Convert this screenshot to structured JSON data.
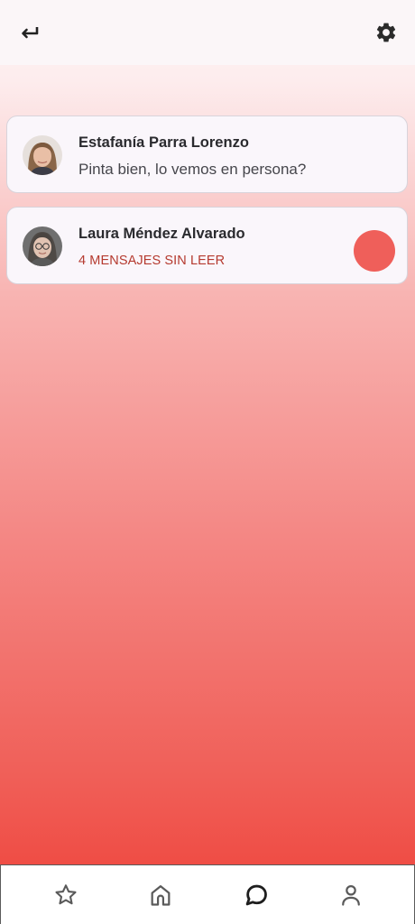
{
  "header": {
    "back_icon": "back-arrow-icon",
    "settings_icon": "gear-icon"
  },
  "conversations": [
    {
      "name": "Estafanía Parra Lorenzo",
      "last_message": "Pinta bien, lo vemos en persona?",
      "avatar": "avatar-photo"
    },
    {
      "name": "Laura Méndez Alvarado",
      "unread_text": "4 MENSAJES SIN LEER",
      "avatar": "avatar-photo",
      "badge_color": "#ef5f5a"
    }
  ],
  "bottom_nav": {
    "items": [
      {
        "icon": "star-icon"
      },
      {
        "icon": "home-icon"
      },
      {
        "icon": "chat-bubble-icon"
      },
      {
        "icon": "person-icon"
      }
    ]
  },
  "colors": {
    "gradient_top": "#fdf6f7",
    "gradient_bottom": "#ef4d45",
    "card_bg": "#faf6fb",
    "unread_text": "#b53a2f"
  }
}
